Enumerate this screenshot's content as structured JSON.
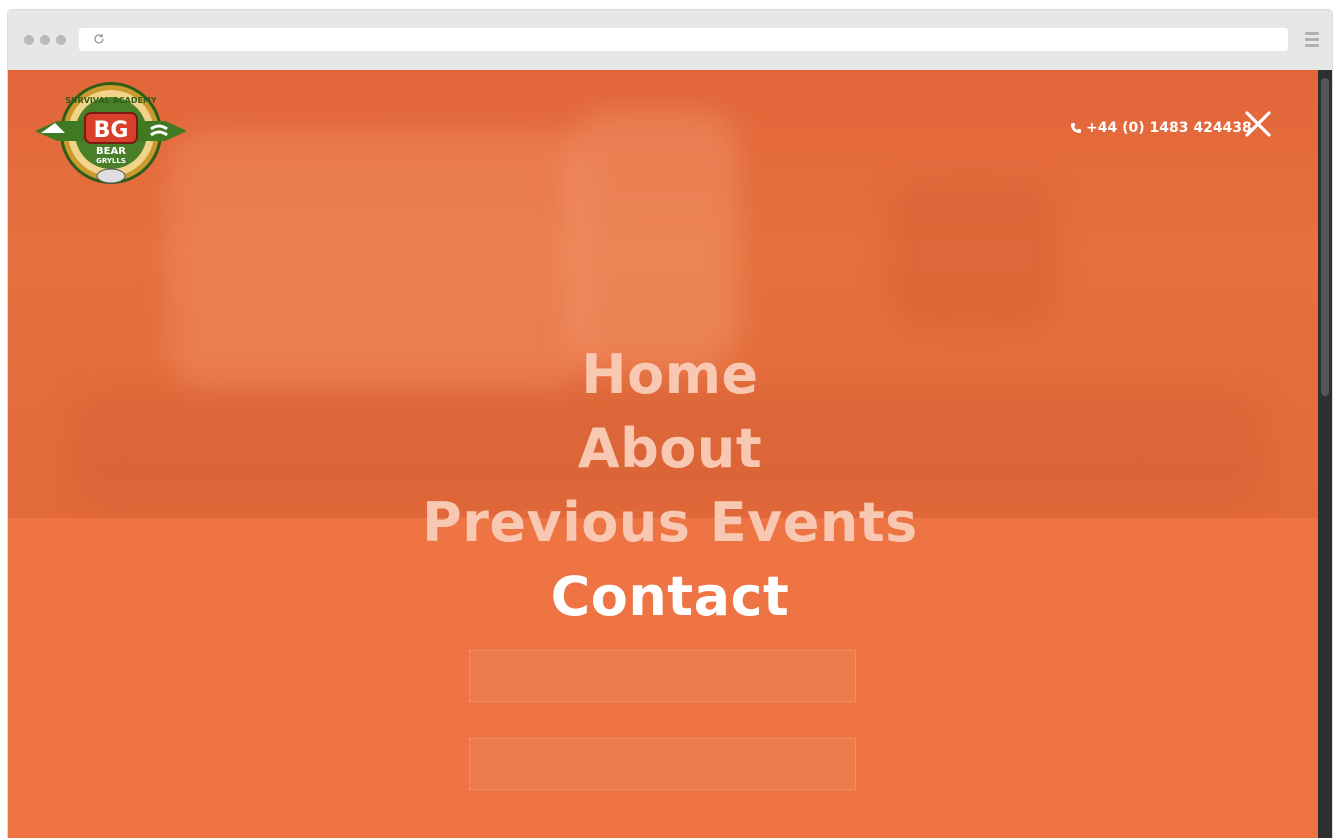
{
  "brand": {
    "logo_top_text": "SURVIVAL ACADEMY",
    "logo_monogram": "BG",
    "logo_name_line1": "BEAR",
    "logo_name_line2": "GRYLLS"
  },
  "header": {
    "phone": "+44 (0) 1483 424438"
  },
  "nav": {
    "items": [
      {
        "label": "Home"
      },
      {
        "label": "About"
      },
      {
        "label": "Previous Events"
      },
      {
        "label": "Contact"
      }
    ]
  },
  "colors": {
    "overlay": "#ef7c4d",
    "nav_inactive": "#f8c8b3",
    "nav_active": "#ffffff",
    "logo_green": "#3f7a22",
    "logo_red": "#d8402b"
  },
  "icons": {
    "reload": "reload-icon",
    "menu": "hamburger-menu-icon",
    "phone": "phone-icon",
    "close": "close-icon"
  }
}
